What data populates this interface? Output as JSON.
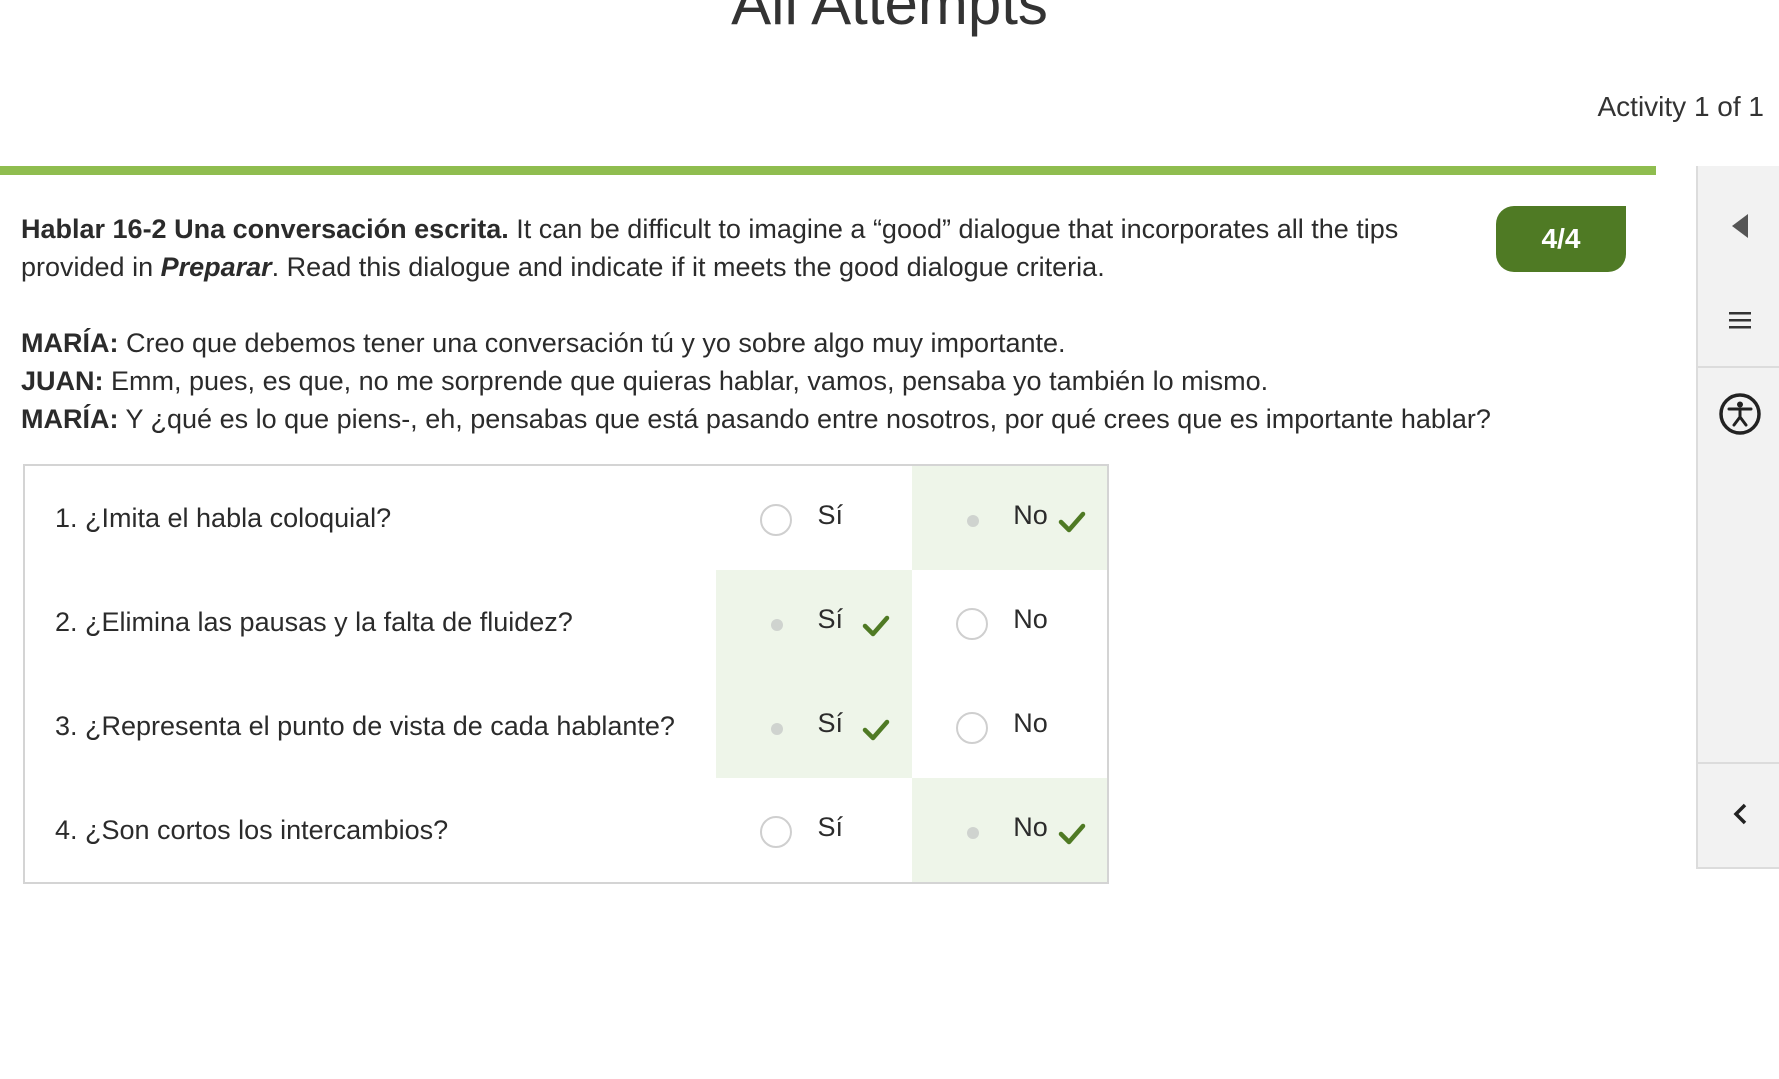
{
  "header": {
    "title": "All Attempts",
    "activity_counter": "Activity 1 of 1",
    "progress_fraction": 1.0
  },
  "activity": {
    "title": "Hablar 16-2 Una conversación escrita.",
    "instructions_part1": " It can be difficult to imagine a “good” dialogue that incorporates all the tips provided in ",
    "instructions_emphasis": "Preparar",
    "instructions_part2": ". Read this dialogue and indicate if it meets the good dialogue criteria.",
    "score": "4/4",
    "dialogue": [
      {
        "speaker": "MARÍA:",
        "text": " Creo que debemos tener una conversación tú y yo sobre algo muy importante."
      },
      {
        "speaker": "JUAN:",
        "text": " Emm, pues, es que, no me sorprende que quieras hablar, vamos, pensaba yo también lo mismo."
      },
      {
        "speaker": "MARÍA:",
        "text": " Y ¿qué es lo que piens-, eh, pensabas que está pasando entre nosotros, por qué crees que es importante hablar?"
      }
    ],
    "option_labels": {
      "yes": "Sí",
      "no": "No"
    },
    "questions": [
      {
        "text": "1. ¿Imita el habla coloquial?",
        "selected": "no",
        "correct": "no"
      },
      {
        "text": "2. ¿Elimina las pausas y la falta de fluidez?",
        "selected": "yes",
        "correct": "yes"
      },
      {
        "text": "3. ¿Representa el punto de vista de cada hablante?",
        "selected": "yes",
        "correct": "yes"
      },
      {
        "text": "4. ¿Son cortos los intercambios?",
        "selected": "no",
        "correct": "no"
      }
    ]
  },
  "colors": {
    "accent_green": "#4f7a24",
    "progress_green": "#8fbd4f",
    "correct_background": "#eef5e9"
  },
  "side_panel": {
    "icons": [
      "triangle-left-icon",
      "menu-icon",
      "accessibility-icon",
      "chevron-left-icon"
    ]
  }
}
